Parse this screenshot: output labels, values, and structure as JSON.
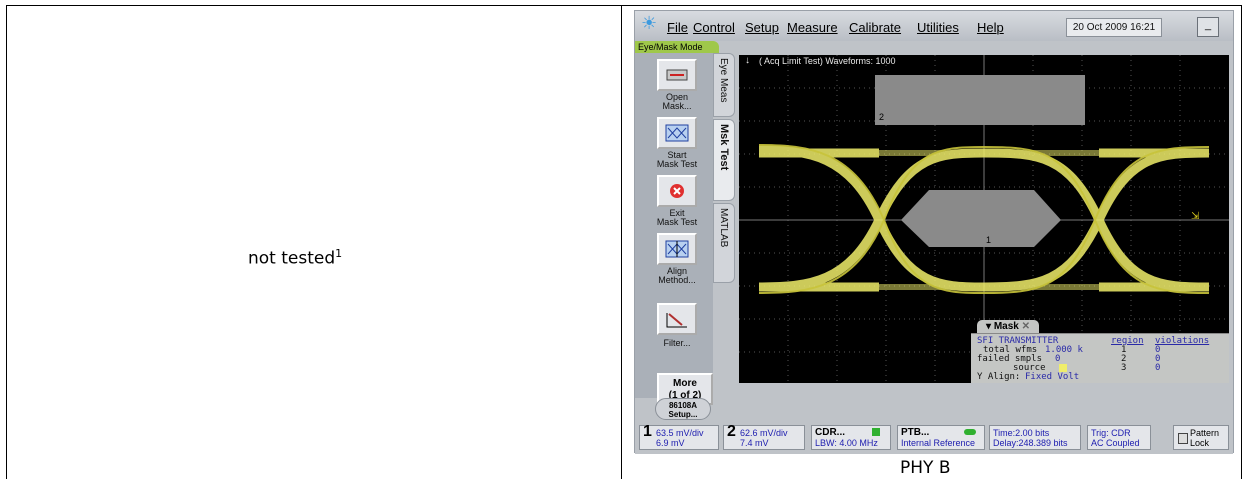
{
  "left_cell": {
    "text": "not tested",
    "footnote": "1"
  },
  "caption": "PHY B",
  "scope": {
    "menu": [
      "File",
      "Control",
      "Setup",
      "Measure",
      "Calibrate",
      "Utilities",
      "Help"
    ],
    "datetime": "20 Oct 2009  16:21",
    "minimize_label": "_",
    "mode_tab": "Eye/Mask Mode",
    "side_buttons": [
      {
        "label": "Open\nMask..."
      },
      {
        "label": "Start\nMask Test"
      },
      {
        "label": "Exit\nMask Test"
      },
      {
        "label": "Align\nMethod..."
      },
      {
        "label": "Filter..."
      }
    ],
    "more_button": "More\n(1 of 2)",
    "setup_button": "86108A\nSetup...",
    "vtabs": [
      "Eye Meas",
      "Msk Test",
      "MATLAB"
    ],
    "acq_text": "( Acq Limit Test)  Waveforms: 1000",
    "region_labels": [
      "2",
      "1"
    ],
    "mask_tab": "Mask",
    "mask_info": {
      "title": "SFI TRANSMITTER",
      "total_wfms_label": "total wfms",
      "total_wfms": "1.000 k",
      "failed_label": "failed smpls",
      "failed": "0",
      "source_label": "source",
      "yalign_label": "Y Align:",
      "yalign": "Fixed Volt",
      "region_header": "region",
      "violations_header": "violations",
      "regions": [
        "1",
        "2",
        "3"
      ],
      "violations": [
        "0",
        "0",
        "0"
      ]
    },
    "status": {
      "ch1": {
        "num": "1",
        "scale": "63.5 mV/div",
        "offset": "6.9 mV"
      },
      "ch2": {
        "num": "2",
        "scale": "62.6 mV/div",
        "offset": "7.4 mV"
      },
      "cdr": {
        "title": "CDR...",
        "sub": "LBW: 4.00 MHz"
      },
      "ptb": {
        "title": "PTB...",
        "sub": "Internal Reference"
      },
      "time": {
        "line1": "Time:2.00 bits",
        "line2": "Delay:248.389 bits"
      },
      "trig": {
        "line1": "Trig: CDR",
        "line2": "AC Coupled"
      },
      "pattern_lock": "Pattern\nLock"
    },
    "colors": {
      "trace": "#f0ee6a",
      "mask": "#8a8a8a",
      "screen": "#000000",
      "mode_tab": "#9fc84a"
    }
  }
}
